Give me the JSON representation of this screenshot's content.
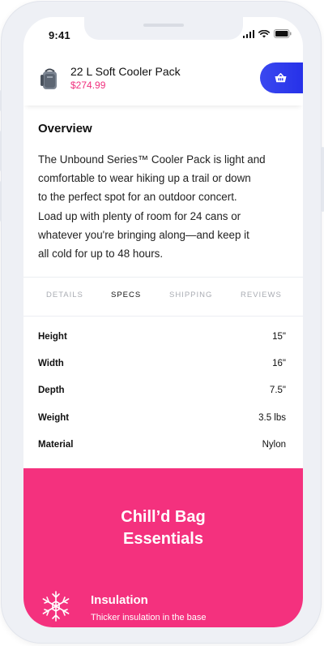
{
  "status_bar": {
    "time": "9:41"
  },
  "product": {
    "name": "22 L Soft Cooler Pack",
    "price": "$274.99"
  },
  "overview": {
    "title": "Overview",
    "lines": [
      "The Unbound Series™ Cooler Pack is light and",
      "comfortable to wear hiking up a trail or down",
      "to the perfect spot for an outdoor concert.",
      "Load up with plenty of room for 24 cans or",
      "whatever you're bringing along—and keep it",
      "all cold for up to 48 hours."
    ]
  },
  "tabs": [
    {
      "label": "DETAILS"
    },
    {
      "label": "SPECS",
      "active": true
    },
    {
      "label": "SHIPPING"
    },
    {
      "label": "REVIEWS"
    }
  ],
  "specs": [
    {
      "label": "Height",
      "value": "15\""
    },
    {
      "label": "Width",
      "value": "16\""
    },
    {
      "label": "Depth",
      "value": "7.5\""
    },
    {
      "label": "Weight",
      "value": "3.5 lbs"
    },
    {
      "label": "Material",
      "value": "Nylon"
    }
  ],
  "essentials": {
    "title_line1": "Chill’d Bag",
    "title_line2": "Essentials",
    "feature": {
      "title": "Insulation",
      "description": "Thicker insulation in the base"
    }
  },
  "colors": {
    "accent_pink": "#f4317e",
    "cart_blue": "#2b36ec",
    "price_pink": "#f0317e"
  },
  "icons": {
    "cart": "basket-icon",
    "feature": "snowflake-icon",
    "wifi": "wifi-icon",
    "battery": "battery-icon",
    "signal": "signal-icon"
  }
}
